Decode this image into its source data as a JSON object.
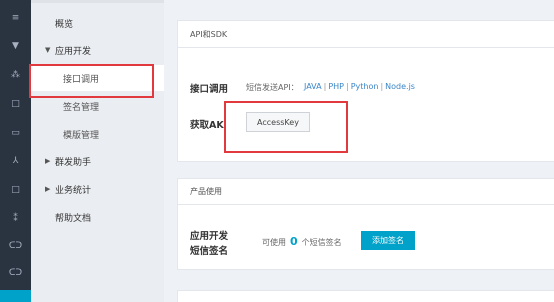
{
  "rail": {
    "icons": [
      "menu-icon",
      "shield-icon",
      "share-icon",
      "square-icon",
      "tablet-icon",
      "person-icon",
      "square-icon",
      "network-icon",
      "brackets-icon",
      "brackets-icon",
      "cloud-icon"
    ],
    "glyphs": [
      "≡",
      "▼",
      "⁂",
      "□",
      "▭",
      "⅄",
      "□",
      "⁑",
      "ᑕᑐ",
      "ᑕᑐ",
      "☁"
    ]
  },
  "nav": {
    "overview": "概览",
    "app_dev": "应用开发",
    "api_call": "接口调用",
    "sign_manage": "签名管理",
    "template_manage": "模版管理",
    "group_send": "群发助手",
    "business_stats": "业务统计",
    "help_docs": "帮助文档",
    "expanded_arrow": "▼",
    "collapsed_arrow": "▶"
  },
  "api_panel": {
    "title": "API和SDK",
    "call_label": "接口调用",
    "sdk_prefix": "短信发送API：",
    "sdk_links": [
      "JAVA",
      "PHP",
      "Python",
      "Node.js"
    ],
    "sdk_sep": "|",
    "ak_label": "获取AK",
    "ak_button": "AccessKey"
  },
  "product_panel": {
    "title": "产品使用",
    "label_line1": "应用开发",
    "label_line2": "短信签名",
    "available_prefix": "可使用",
    "available_count": "0",
    "available_suffix": "个短信签名",
    "add_button": "添加签名"
  },
  "colors": {
    "accent": "#00a2ca",
    "highlight": "#e2393e",
    "rail_bg": "#2a3340"
  }
}
